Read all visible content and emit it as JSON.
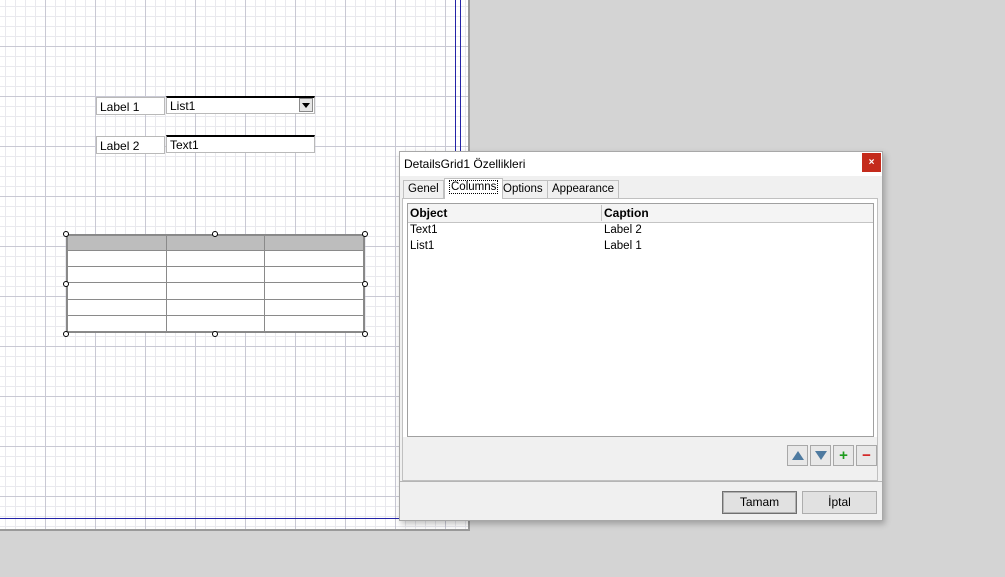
{
  "canvas": {
    "fields": [
      {
        "label": "Label 1",
        "value": "List1",
        "kind": "combo"
      },
      {
        "label": "Label 2",
        "value": "Text1",
        "kind": "text"
      }
    ]
  },
  "dialog": {
    "title": "DetailsGrid1 Özellikleri",
    "close_icon": "×",
    "tabs": [
      "Genel",
      "Columns",
      "Options",
      "Appearance"
    ],
    "active_tab": "Columns",
    "columns_list": {
      "headers": [
        "Object",
        "Caption"
      ],
      "rows": [
        {
          "object": "Text1",
          "caption": "Label 2"
        },
        {
          "object": "List1",
          "caption": "Label 1"
        }
      ]
    },
    "buttons": {
      "ok_label": "Tamam",
      "cancel_label": "İptal"
    },
    "icons": [
      "move-up-icon",
      "move-down-icon",
      "add-icon",
      "remove-icon"
    ]
  },
  "colors": {
    "close_button": "#c42b1c",
    "margin_line": "#2323a8",
    "grid_header": "#bdbdbd"
  }
}
